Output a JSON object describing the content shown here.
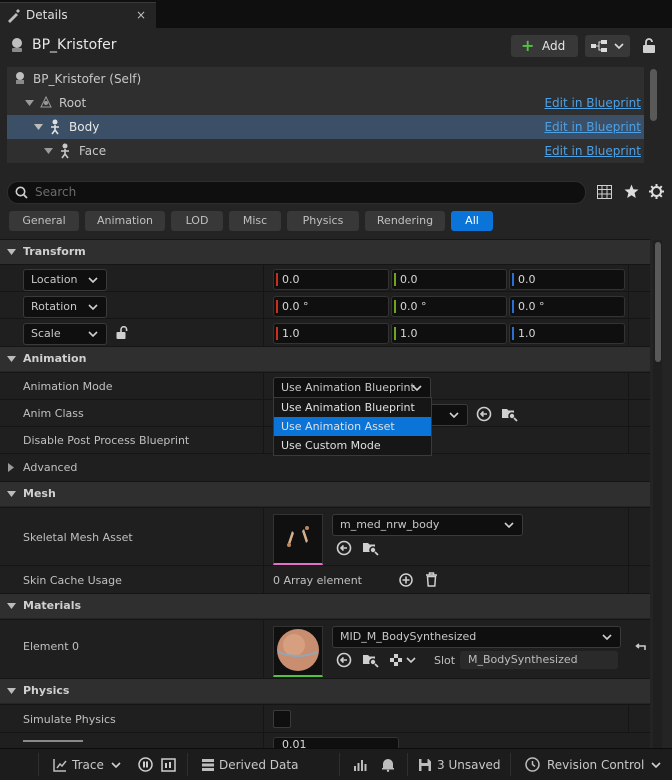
{
  "tab": {
    "title": "Details",
    "close": "×"
  },
  "header": {
    "title": "BP_Kristofer",
    "add_label": "Add"
  },
  "tree": {
    "rows": [
      {
        "label": "BP_Kristofer (Self)",
        "link": ""
      },
      {
        "label": "Root",
        "link": "Edit in Blueprint"
      },
      {
        "label": "Body",
        "link": "Edit in Blueprint"
      },
      {
        "label": "Face",
        "link": "Edit in Blueprint"
      }
    ]
  },
  "search": {
    "placeholder": "Search"
  },
  "filters": [
    "General",
    "Animation",
    "LOD",
    "Misc",
    "Physics",
    "Rendering",
    "All"
  ],
  "active_filter": "All",
  "sections": {
    "transform": "Transform",
    "animation": "Animation",
    "mesh": "Mesh",
    "materials": "Materials",
    "physics": "Physics"
  },
  "transform": {
    "location": {
      "label": "Location",
      "x": "0.0",
      "y": "0.0",
      "z": "0.0"
    },
    "rotation": {
      "label": "Rotation",
      "x": "0.0 °",
      "y": "0.0 °",
      "z": "0.0 °"
    },
    "scale": {
      "label": "Scale",
      "x": "1.0",
      "y": "1.0",
      "z": "1.0"
    }
  },
  "animation": {
    "mode_label": "Animation Mode",
    "mode_value": "Use Animation Blueprint",
    "anim_class_label": "Anim Class",
    "disable_pp_label": "Disable Post Process Blueprint",
    "advanced_label": "Advanced",
    "dropdown_options": [
      "Use Animation Blueprint",
      "Use Animation Asset",
      "Use Custom Mode"
    ],
    "dropdown_highlighted": "Use Animation Asset"
  },
  "mesh": {
    "skeletal_label": "Skeletal Mesh Asset",
    "skeletal_value": "m_med_nrw_body",
    "skin_cache_label": "Skin Cache Usage",
    "skin_cache_value": "0 Array element"
  },
  "materials": {
    "element_label": "Element 0",
    "element_value": "MID_M_BodySynthesized",
    "slot_label": "Slot",
    "slot_value": "M_BodySynthesized"
  },
  "physics": {
    "simulate_label": "Simulate Physics",
    "simulate_checked": false,
    "partial_value": "0.01"
  },
  "statusbar": {
    "trace": "Trace",
    "derived": "Derived Data",
    "unsaved": "3 Unsaved",
    "revision": "Revision Control"
  },
  "colors": {
    "accent": "#0a74d9",
    "link": "#4ea1e5",
    "x_axis": "#c8301c",
    "y_axis": "#6ea51e",
    "z_axis": "#2d6fd1"
  }
}
